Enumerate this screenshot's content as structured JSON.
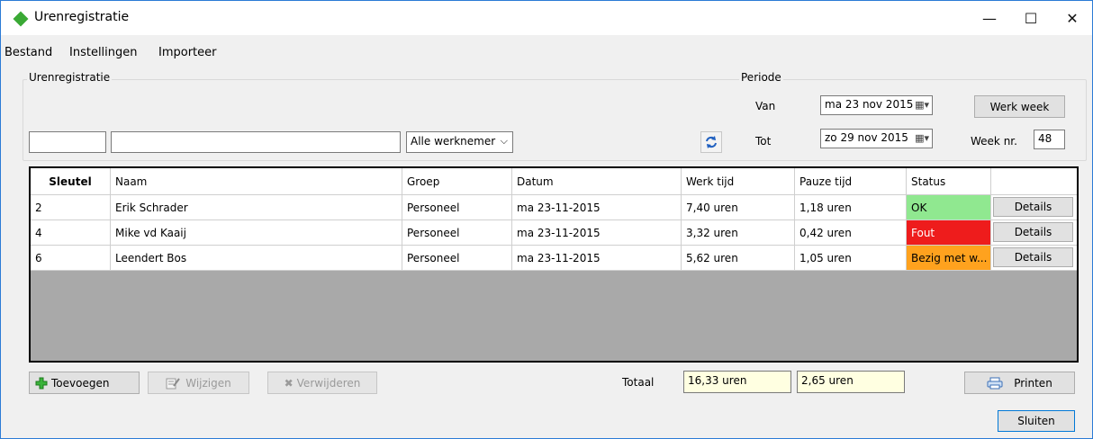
{
  "window": {
    "title": "Urenregistratie",
    "accent": "#2b7bd6",
    "controls": {
      "minimize": "—",
      "maximize": "☐",
      "close": "✕"
    }
  },
  "menu": [
    "Bestand",
    "Instellingen",
    "Importeer"
  ],
  "filter": {
    "group_label": "Urenregistratie",
    "key_value": "",
    "name_value": "",
    "employee_select": "Alle werknemer",
    "refresh_icon": "refresh-icon"
  },
  "period": {
    "group_label": "Periode",
    "from_label": "Van",
    "from_value": "ma 23 nov 2015",
    "to_label": "Tot",
    "to_value": "zo 29 nov 2015",
    "workweek_button": "Werk week",
    "weeknr_label": "Week nr.",
    "weeknr_value": "48"
  },
  "grid": {
    "columns": [
      "Sleutel",
      "Naam",
      "Groep",
      "Datum",
      "Werk tijd",
      "Pauze tijd",
      "Status",
      ""
    ],
    "rows": [
      {
        "key": "2",
        "name": "Erik Schrader",
        "group": "Personeel",
        "date": "ma 23-11-2015",
        "work": "7,40 uren",
        "pause": "1,18 uren",
        "status": "OK",
        "status_color": "#90e890",
        "details": "Details"
      },
      {
        "key": "4",
        "name": "Mike vd Kaaij",
        "group": "Personeel",
        "date": "ma 23-11-2015",
        "work": "3,32 uren",
        "pause": "0,42 uren",
        "status": "Fout",
        "status_color": "#ee1c1c",
        "details": "Details"
      },
      {
        "key": "6",
        "name": "Leendert Bos",
        "group": "Personeel",
        "date": "ma 23-11-2015",
        "work": "5,62 uren",
        "pause": "1,05 uren",
        "status": "Bezig met w...",
        "status_color": "#ffa21e",
        "details": "Details"
      }
    ]
  },
  "actions": {
    "add": "Toevoegen",
    "edit": "Wijzigen",
    "delete": "Verwijderen"
  },
  "totals": {
    "label": "Totaal",
    "work": "16,33 uren",
    "pause": "2,65 uren"
  },
  "print_button": "Printen",
  "close_button": "Sluiten"
}
